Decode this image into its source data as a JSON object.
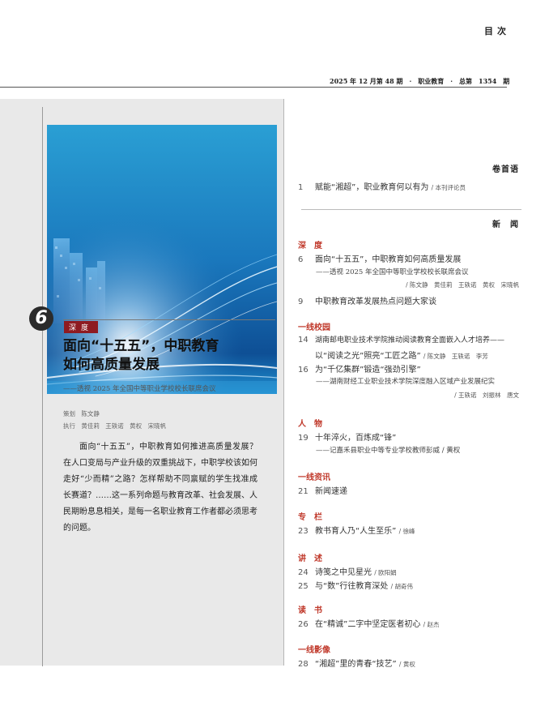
{
  "header": {
    "toc_title": "目次",
    "issue_info": "2025 年 12 月第 48 期　·　职业教育　·　总第　1354　期"
  },
  "feature": {
    "number": "6",
    "tag": "深度",
    "title_line1": "面向“十五五”，中职教育",
    "title_line2": "如何高质量发展",
    "subtitle": "——透视 2025 年全国中等职业学校校长联席会议",
    "planning_label": "策划",
    "planning_names": "陈文静",
    "exec_label": "执行",
    "exec_names": [
      "黄佳莉",
      "王轶诺",
      "黄权",
      "宋晓帆"
    ],
    "body": "面向“十五五”，中职教育如何推进高质量发展？在人口变局与产业升级的双重挑战下，中职学校该如何走好“少而精”之路？怎样帮助不同禀赋的学生找准成长赛道？……这一系列命题与教育改革、社会发展、人民期盼息息相关，是每一名职业教育工作者都必须思考的问题。"
  },
  "toc": {
    "preface_head": "卷首语",
    "preface_no": "1",
    "preface_title": "赋能“湘超”，职业教育何以有为",
    "preface_auth": "/ 本刊评论员",
    "news_head": "新　闻",
    "cat_depth": "深度",
    "e6_no": "6",
    "e6_title": "面向“十五五”，中职教育如何高质量发展",
    "e6_sub": "——透视 2025 年全国中等职业学校校长联席会议",
    "e6_auth": "/ 陈文静　黄佳莉　王轶诺　黄权　宋晓帆",
    "e9_no": "9",
    "e9_title": "中职教育改革发展热点问题大家谈",
    "cat_campus": "一线校园",
    "e14_no": "14",
    "e14_title": "湖南邮电职业技术学院推动阅读教育全面嵌入人才培养——",
    "e14_line2": "以“阅读之光”照亮“工匠之路”",
    "e14_auth": "/ 陈文静　王轶诺　李芳",
    "e16_no": "16",
    "e16_title": "为“千亿集群”锻造“强劲引擎”",
    "e16_sub": "——湖南财经工业职业技术学院深度融入区域产业发展纪实",
    "e16_auth": "/ 王轶诺　刘振林　唐文",
    "cat_people": "人物",
    "e19_no": "19",
    "e19_title": "十年淬火，百炼成“锋”",
    "e19_sub": "——记嘉禾县职业中等专业学校教师彭威",
    "e19_auth": "/ 黄权",
    "cat_info": "一线资讯",
    "e21_no": "21",
    "e21_title": "新闻速递",
    "cat_column": "专栏",
    "e23_no": "23",
    "e23_title": "教书育人乃“人生至乐”",
    "e23_auth": "/ 徐峰",
    "cat_lecture": "讲述",
    "e24_no": "24",
    "e24_title": "诗笺之中见星光",
    "e24_auth": "/ 欧阳娟",
    "e25_no": "25",
    "e25_title": "与“数”行往教育深处",
    "e25_auth": "/ 胡奇伟",
    "cat_reading": "读书",
    "e26_no": "26",
    "e26_title": "在“精诚”二字中坚定医者初心",
    "e26_auth": "/ 赵杰",
    "cat_image": "一线影像",
    "e28_no": "28",
    "e28_title": "“湘超”里的青春“技艺”",
    "e28_auth": "/ 黄权"
  }
}
